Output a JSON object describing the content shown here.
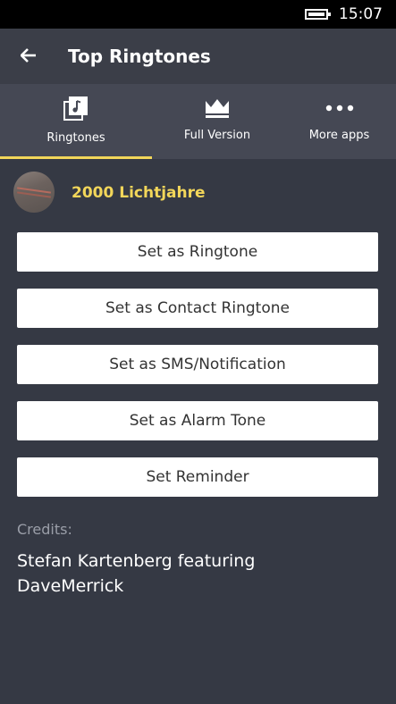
{
  "status_bar": {
    "time": "15:07",
    "battery_icon": "battery-full-icon"
  },
  "header": {
    "back_icon": "arrow-left-icon",
    "title": "Top Ringtones"
  },
  "tabs": [
    {
      "label": "Ringtones",
      "icon": "music-library-icon",
      "selected": true
    },
    {
      "label": "Full Version",
      "icon": "crown-icon",
      "selected": false
    },
    {
      "label": "More apps",
      "icon": "more-dots-icon",
      "selected": false
    }
  ],
  "song": {
    "title": "2000 Lichtjahre"
  },
  "actions": [
    {
      "label": "Set as Ringtone"
    },
    {
      "label": "Set as Contact Ringtone"
    },
    {
      "label": "Set as SMS/Notification"
    },
    {
      "label": "Set as Alarm Tone"
    },
    {
      "label": "Set Reminder"
    }
  ],
  "credits": {
    "label": "Credits:",
    "text": "Stefan Kartenberg featuring DaveMerrick"
  },
  "colors": {
    "accent": "#f2d65a",
    "background": "#353944",
    "header": "#3b3e48",
    "tabs": "#454854"
  }
}
